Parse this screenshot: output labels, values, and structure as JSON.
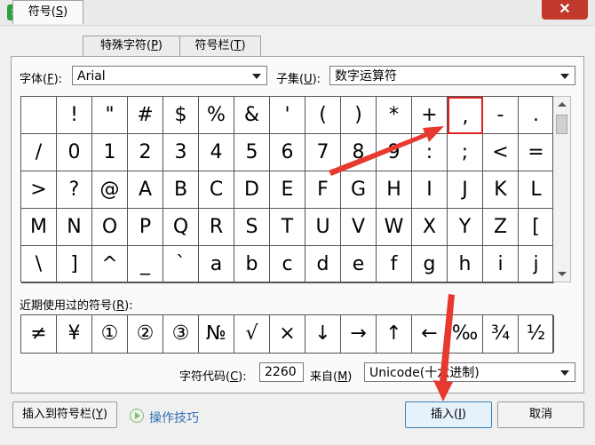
{
  "window": {
    "title": "符号",
    "app_icon_letter": "S"
  },
  "tabs": [
    {
      "label": "符号(S)",
      "hotkey_label": "符号(",
      "hotkey": "S",
      "tail": ")",
      "active": true
    },
    {
      "label": "特殊字符(P)",
      "hotkey_label": "特殊字符(",
      "hotkey": "P",
      "tail": ")",
      "active": false
    },
    {
      "label": "符号栏(T)",
      "hotkey_label": "符号栏(",
      "hotkey": "T",
      "tail": ")",
      "active": false
    }
  ],
  "font": {
    "label_pre": "字体(",
    "hotkey": "F",
    "label_post": "):",
    "value": "Arial"
  },
  "subset": {
    "label_pre": "子集(",
    "hotkey": "U",
    "label_post": "):",
    "value": "数字运算符"
  },
  "symbol_grid": {
    "rows": [
      [
        "",
        "!",
        "\"",
        "#",
        "$",
        "%",
        "&",
        "'",
        "(",
        ")",
        "*",
        "+",
        ",",
        "-",
        "."
      ],
      [
        "/",
        "0",
        "1",
        "2",
        "3",
        "4",
        "5",
        "6",
        "7",
        "8",
        "9",
        ":",
        ";",
        "<",
        "="
      ],
      [
        ">",
        "?",
        "@",
        "A",
        "B",
        "C",
        "D",
        "E",
        "F",
        "G",
        "H",
        "I",
        "J",
        "K",
        "L"
      ],
      [
        "M",
        "N",
        "O",
        "P",
        "Q",
        "R",
        "S",
        "T",
        "U",
        "V",
        "W",
        "X",
        "Y",
        "Z",
        "["
      ],
      [
        "\\",
        "]",
        "^",
        "_",
        "`",
        "a",
        "b",
        "c",
        "d",
        "e",
        "f",
        "g",
        "h",
        "i",
        "j"
      ]
    ],
    "selected": {
      "row": 0,
      "col": 12
    }
  },
  "recent": {
    "label_pre": "近期使用过的符号(",
    "hotkey": "R",
    "label_post": "):",
    "symbols": [
      "≠",
      "¥",
      "①",
      "②",
      "③",
      "№",
      "√",
      "×",
      "↓",
      "→",
      "↑",
      "←",
      "‰",
      "¾",
      "½"
    ]
  },
  "char_code": {
    "label_pre": "字符代码(",
    "hotkey": "C",
    "label_post": "):",
    "value": "2260"
  },
  "from": {
    "label_pre": "来自(",
    "hotkey": "M",
    "label_post": ")",
    "value": "Unicode(十六进制)"
  },
  "buttons": {
    "insert_to_bar": {
      "pre": "插入到符号栏(",
      "hotkey": "Y",
      "post": ")"
    },
    "tips": "操作技巧",
    "insert": {
      "pre": "插入(",
      "hotkey": "I",
      "post": ")"
    },
    "cancel": "取消"
  },
  "colors": {
    "selection": "#e02020",
    "annotation_arrow": "#e8392f",
    "tips": "#2f70b3"
  }
}
